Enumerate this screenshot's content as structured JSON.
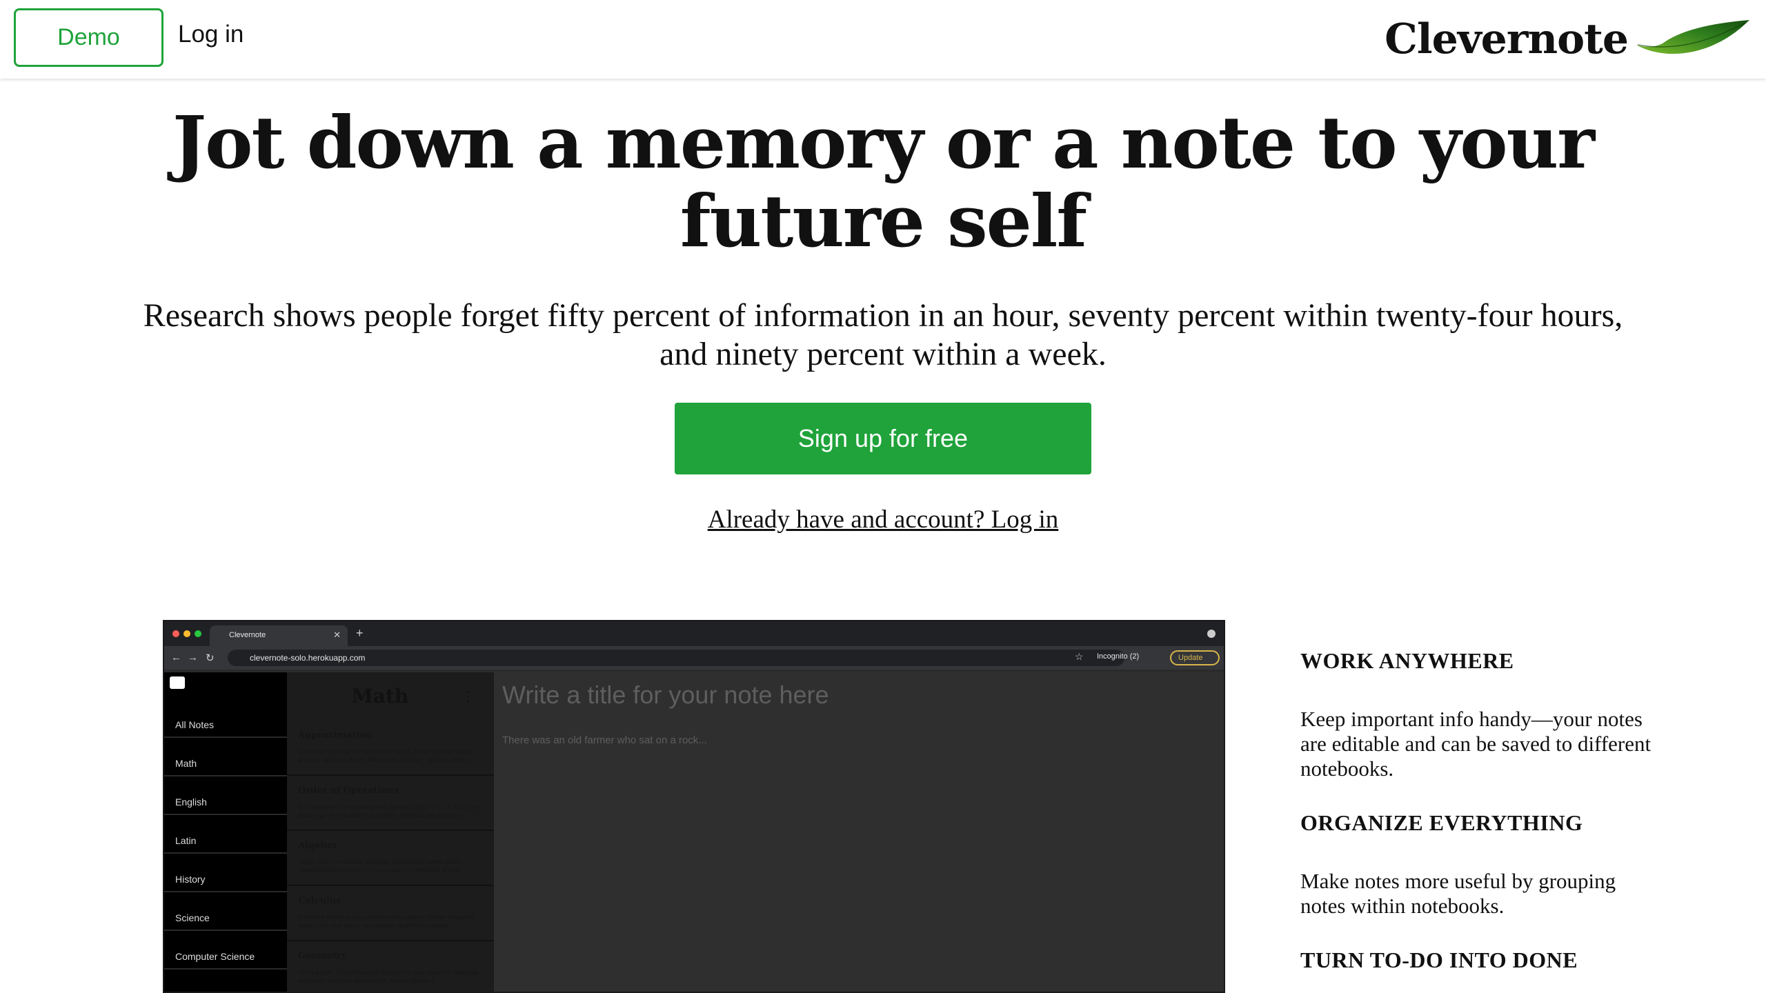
{
  "header": {
    "demo_label": "Demo",
    "login_label": "Log in",
    "brand": "Clevernote",
    "logo_icon": "leaf-icon",
    "accent_color": "#1fa33a"
  },
  "hero": {
    "title": "Jot down a memory or a note to your future self",
    "subtitle": "Research shows people forget fifty percent of information in an hour, seventy percent within twenty-four hours, and ninety percent within a week.",
    "signup_label": "Sign up for free",
    "already_link": "Already have and account? Log in"
  },
  "app_screenshot": {
    "tab_title": "Clevernote",
    "url": "clevernote-solo.herokuapp.com",
    "incognito": "Incognito (2)",
    "update_label": "Update",
    "sidebar": [
      "All Notes",
      "Math",
      "English",
      "Latin",
      "History",
      "Science",
      "Computer Science"
    ],
    "notebook_title": "Math",
    "notes": [
      {
        "title": "Approximation",
        "preview": "When we round up or round down values, these rounded values are only approximations. We use the symbol ' ' isobore approx..."
      },
      {
        "title": "Order of Operations",
        "preview": "An expression has numbers and operation signs (+, -, x, ÷) but no equal sign. An equation is a number sentence with an equ..."
      },
      {
        "title": "Algebra",
        "preview": "neque rerum! Provident similique accusantium nemo autem. Veritatisfacerati tenetur hos eius earum ut molestias archite..."
      },
      {
        "title": "Calculus",
        "preview": "Provident similique accusantium nemo autem. Veritati obcaecati tenetur hos eius earum ut molestias architecto volupta..."
      },
      {
        "title": "Geometry",
        "preview": "nemo autem. Veritatisfacerati tenetur hos eius earum ut molestias architecto voluptate aliquammilli, eveniet aliquid s..."
      }
    ],
    "editor_title_placeholder": "Write a title for your note here",
    "editor_body": "There was an old farmer who sat on a rock..."
  },
  "features": [
    {
      "heading": "WORK ANYWHERE",
      "text": "Keep important info handy—your notes are editable and can be saved to different notebooks."
    },
    {
      "heading": "ORGANIZE EVERYTHING",
      "text": "Make notes more useful by grouping notes within notebooks."
    },
    {
      "heading": "TURN TO-DO INTO DONE",
      "text": ""
    }
  ]
}
